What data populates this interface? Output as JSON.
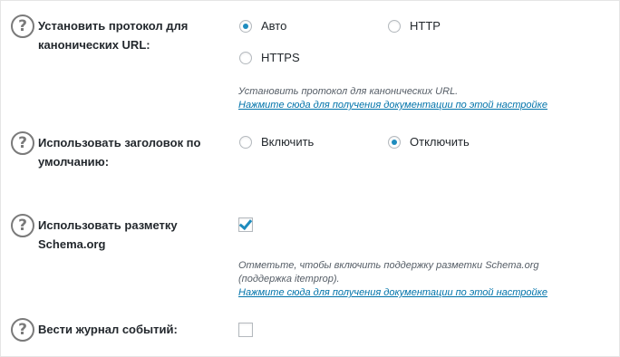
{
  "settings": [
    {
      "label": "Установить протокол для канонических URL:",
      "options": [
        {
          "label": "Авто",
          "checked": true
        },
        {
          "label": "HTTP",
          "checked": false
        },
        {
          "label": "HTTPS",
          "checked": false
        }
      ],
      "description": "Установить протокол для канонических URL.",
      "doc_link": "Нажмите сюда для получения документации по этой настройке"
    },
    {
      "label": "Использовать заголовок по умолчанию:",
      "options": [
        {
          "label": "Включить",
          "checked": false
        },
        {
          "label": "Отключить",
          "checked": true
        }
      ]
    },
    {
      "label": "Использовать разметку Schema.org",
      "checked": true,
      "description": "Отметьте, чтобы включить поддержку разметки Schema.org (поддержка itemprop).",
      "doc_link": "Нажмите сюда для получения документации по этой настройке"
    },
    {
      "label": "Вести журнал событий:",
      "checked": false
    }
  ],
  "help_icon_glyph": "?",
  "accent_color": "#1e8cbe",
  "link_color": "#0073aa"
}
